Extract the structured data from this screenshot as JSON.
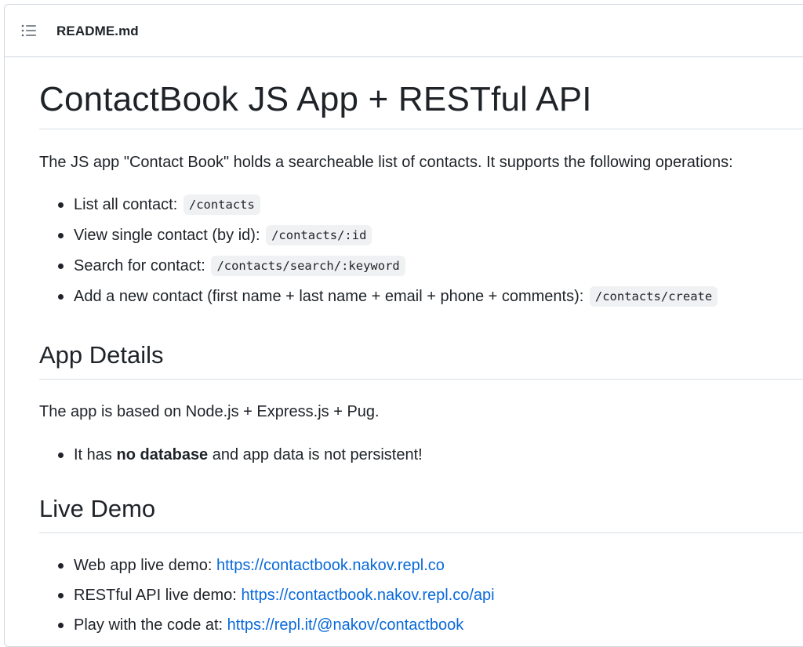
{
  "file_header": {
    "icon": "list-unordered-icon",
    "filename": "README.md"
  },
  "readme": {
    "title": "ContactBook JS App + RESTful API",
    "intro": "The JS app \"Contact Book\" holds a searcheable list of contacts. It supports the following operations:",
    "operations": [
      {
        "label": "List all contact:",
        "code": "/contacts"
      },
      {
        "label": "View single contact (by id):",
        "code": "/contacts/:id"
      },
      {
        "label": "Search for contact:",
        "code": "/contacts/search/:keyword"
      },
      {
        "label": "Add a new contact (first name + last name + email + phone + comments):",
        "code": "/contacts/create"
      }
    ],
    "app_details": {
      "heading": "App Details",
      "text": "The app is based on Node.js + Express.js + Pug.",
      "bullet_prefix": "It has",
      "bullet_bold": "no database",
      "bullet_suffix": "and app data is not persistent!"
    },
    "live_demo": {
      "heading": "Live Demo",
      "items": [
        {
          "label": "Web app live demo:",
          "link": "https://contactbook.nakov.repl.co"
        },
        {
          "label": "RESTful API live demo:",
          "link": "https://contactbook.nakov.repl.co/api"
        },
        {
          "label": "Play with the code at:",
          "link": "https://repl.it/@nakov/contactbook"
        }
      ]
    }
  },
  "colors": {
    "text": "#1f2328",
    "link": "#0969da",
    "border": "#d0d7de",
    "code_bg": "#eff1f3"
  }
}
